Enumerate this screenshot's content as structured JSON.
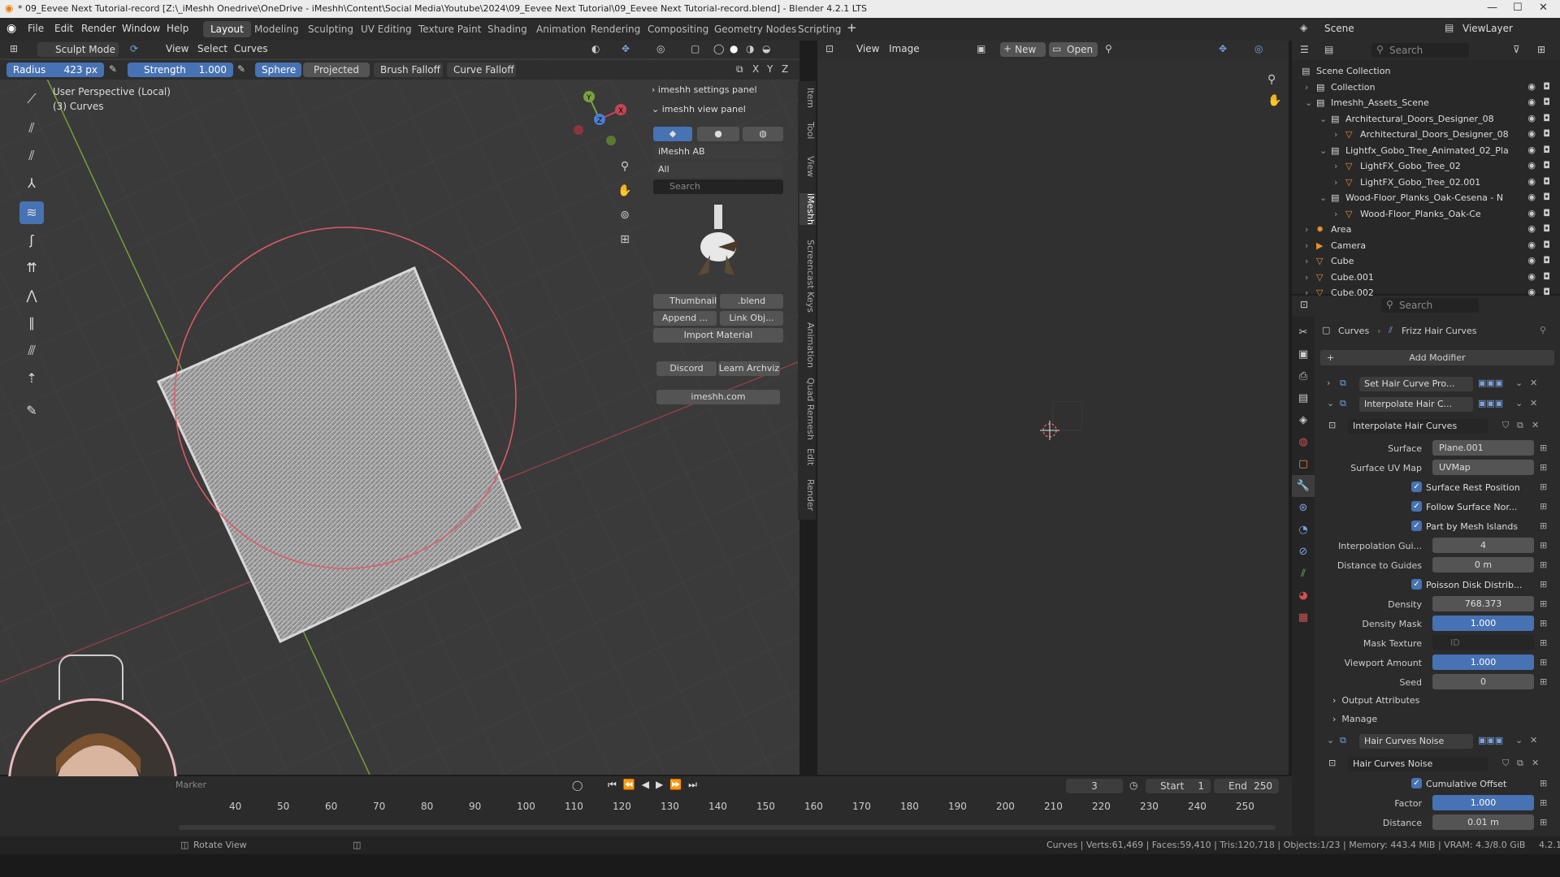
{
  "window": {
    "title": "* 09_Eevee Next Tutorial-record [Z:\\_iMeshh Onedrive\\OneDrive - iMeshh\\Content\\Social Media\\Youtube\\2024\\09_Eevee Next Tutorial\\09_Eevee Next Tutorial-record.blend] - Blender 4.2.1 LTS"
  },
  "menu": [
    "File",
    "Edit",
    "Render",
    "Window",
    "Help"
  ],
  "workspaces": [
    "Layout",
    "Modeling",
    "Sculpting",
    "UV Editing",
    "Texture Paint",
    "Shading",
    "Animation",
    "Rendering",
    "Compositing",
    "Geometry Nodes",
    "Scripting"
  ],
  "active_workspace": "Layout",
  "scene": {
    "label": "Scene",
    "viewlayer": "ViewLayer"
  },
  "viewport": {
    "mode": "Sculpt Mode",
    "header_menus": [
      "View",
      "Select",
      "Curves"
    ],
    "radius_label": "Radius",
    "radius_value": "423 px",
    "strength_label": "Strength",
    "strength_value": "1.000",
    "sphere": "Sphere",
    "projected": "Projected",
    "brush_falloff": "Brush Falloff",
    "curve_falloff": "Curve Falloff",
    "axis_x": "X",
    "axis_y": "Y",
    "axis_z": "Z",
    "overlay_line1": "User Perspective (Local)",
    "overlay_line2": "(3) Curves",
    "gizmo_x": "X",
    "gizmo_y": "Y",
    "gizmo_z": "Z"
  },
  "npanel": {
    "settings_panel": "imeshh settings panel",
    "view_panel": "imeshh view panel",
    "library": "iMeshh AB",
    "filter": "All",
    "search_placeholder": "Search",
    "thumbnail": "Thumbnail",
    "blend": ".blend",
    "append": "Append ...",
    "link": "Link Obj...",
    "import_material": "Import Material",
    "discord": "Discord",
    "learn": "Learn Archviz",
    "site": "imeshh.com",
    "tabs": [
      "Item",
      "Tool",
      "View",
      "iMeshh",
      "Screencast Keys",
      "Animation",
      "Quad Remesh",
      "Edit",
      "Render"
    ]
  },
  "image_editor": {
    "menus": [
      "View",
      "Image"
    ],
    "new": "New",
    "open": "Open"
  },
  "outliner": {
    "search_placeholder": "Search",
    "rows": [
      {
        "label": "Scene Collection",
        "indent": 0
      },
      {
        "label": "Collection",
        "indent": 1
      },
      {
        "label": "Imeshh_Assets_Scene",
        "indent": 1
      },
      {
        "label": "Architectural_Doors_Designer_08",
        "indent": 2
      },
      {
        "label": "Architectural_Doors_Designer_08",
        "indent": 3
      },
      {
        "label": "Lightfx_Gobo_Tree_Animated_02_Pla",
        "indent": 2
      },
      {
        "label": "LightFX_Gobo_Tree_02",
        "indent": 3
      },
      {
        "label": "LightFX_Gobo_Tree_02.001",
        "indent": 3
      },
      {
        "label": "Wood-Floor_Planks_Oak-Cesena - N",
        "indent": 2
      },
      {
        "label": "Wood-Floor_Planks_Oak-Ce",
        "indent": 3
      },
      {
        "label": "Area",
        "indent": 1
      },
      {
        "label": "Camera",
        "indent": 1
      },
      {
        "label": "Cube",
        "indent": 1
      },
      {
        "label": "Cube.001",
        "indent": 1
      },
      {
        "label": "Cube.002",
        "indent": 1
      }
    ]
  },
  "properties": {
    "search_placeholder": "Search",
    "breadcrumb_obj": "Curves",
    "breadcrumb_mod": "Frizz Hair Curves",
    "add_modifier": "Add Modifier",
    "mod1": "Set Hair Curve Pro...",
    "mod2": "Interpolate Hair C...",
    "mod2_group": "Interpolate Hair Curves",
    "surface_label": "Surface",
    "surface_value": "Plane.001",
    "uvmap_label": "Surface UV Map",
    "uvmap_value": "UVMap",
    "surface_rest": "Surface Rest Position",
    "follow_normal": "Follow Surface Nor...",
    "part_islands": "Part by Mesh Islands",
    "interp_label": "Interpolation Gui...",
    "interp_value": "4",
    "dist_label": "Distance to Guides",
    "dist_value": "0 m",
    "poisson": "Poisson Disk Distrib...",
    "density_label": "Density",
    "density_value": "768.373",
    "density_mask_label": "Density Mask",
    "density_mask_value": "1.000",
    "mask_tex_label": "Mask Texture",
    "mask_tex_value": "ID",
    "viewport_amount_label": "Viewport Amount",
    "viewport_amount_value": "1.000",
    "seed_label": "Seed",
    "seed_value": "0",
    "output_attrs": "Output Attributes",
    "manage": "Manage",
    "mod3": "Hair Curves Noise",
    "mod3_group": "Hair Curves Noise",
    "cumulative": "Cumulative Offset",
    "factor_label": "Factor",
    "factor_value": "1.000",
    "distance_label": "Distance",
    "distance_value": "0.01 m"
  },
  "timeline": {
    "marker": "Marker",
    "current_frame": "3",
    "start_label": "Start",
    "start_value": "1",
    "end_label": "End",
    "end_value": "250",
    "ticks": [
      "40",
      "50",
      "60",
      "70",
      "80",
      "90",
      "100",
      "110",
      "120",
      "130",
      "140",
      "150",
      "160",
      "170",
      "180",
      "190",
      "200",
      "210",
      "220",
      "230",
      "240",
      "250"
    ]
  },
  "status": {
    "rotate": "Rotate View",
    "stats": "Curves | Verts:61,469 | Faces:59,410 | Tris:120,718 | Objects:1/23 | Memory: 443.4 MiB | VRAM: 4.3/8.0 GiB",
    "version": "4.2.1"
  },
  "colors": {
    "accent": "#4772b3",
    "viewport_bg": "#3a3a3a",
    "panel_bg": "#2b2b2b"
  }
}
